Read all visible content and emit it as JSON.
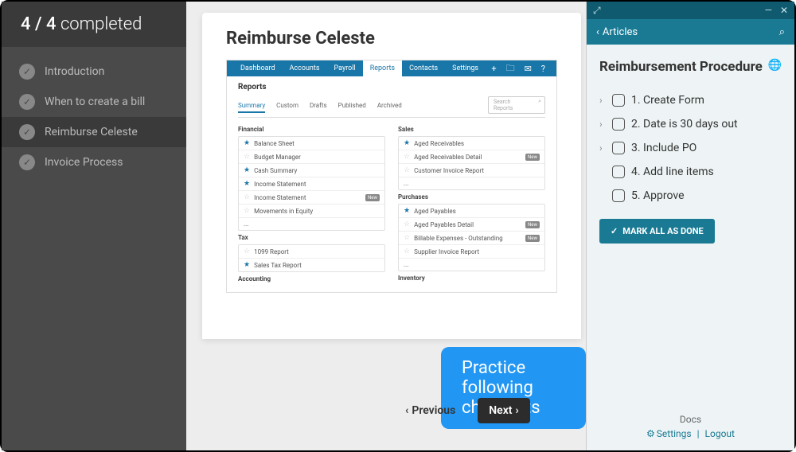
{
  "progress": {
    "done": "4",
    "total": "4",
    "suffix": "completed"
  },
  "sidebar": {
    "items": [
      {
        "label": "Introduction"
      },
      {
        "label": "When to create a bill"
      },
      {
        "label": "Reimburse Celeste"
      },
      {
        "label": "Invoice Process"
      }
    ]
  },
  "main": {
    "title": "Reimburse Celeste",
    "embed": {
      "nav": [
        "Dashboard",
        "Accounts",
        "Payroll",
        "Reports",
        "Contacts",
        "Settings"
      ],
      "nav_active": "Reports",
      "heading": "Reports",
      "tabs": [
        "Summary",
        "Custom",
        "Drafts",
        "Published",
        "Archived"
      ],
      "tab_active": "Summary",
      "search_placeholder": "Search Reports",
      "sections": {
        "financial": {
          "title": "Financial",
          "rows": [
            {
              "star": true,
              "label": "Balance Sheet"
            },
            {
              "star": false,
              "label": "Budget Manager"
            },
            {
              "star": true,
              "label": "Cash Summary"
            },
            {
              "star": true,
              "label": "Income Statement"
            },
            {
              "star": false,
              "label": "Income Statement",
              "badge": "New"
            },
            {
              "star": false,
              "label": "Movements in Equity"
            },
            {
              "star": false,
              "label": "..."
            }
          ]
        },
        "tax": {
          "title": "Tax",
          "rows": [
            {
              "star": false,
              "label": "1099 Report"
            },
            {
              "star": true,
              "label": "Sales Tax Report"
            }
          ]
        },
        "accounting": {
          "title": "Accounting"
        },
        "sales": {
          "title": "Sales",
          "rows": [
            {
              "star": true,
              "label": "Aged Receivables"
            },
            {
              "star": false,
              "label": "Aged Receivables Detail",
              "badge": "New"
            },
            {
              "star": false,
              "label": "Customer Invoice Report"
            },
            {
              "star": false,
              "label": "..."
            }
          ]
        },
        "purchases": {
          "title": "Purchases",
          "rows": [
            {
              "star": true,
              "label": "Aged Payables"
            },
            {
              "star": false,
              "label": "Aged Payables Detail",
              "badge": "New"
            },
            {
              "star": false,
              "label": "Billable Expenses - Outstanding",
              "badge": "New"
            },
            {
              "star": false,
              "label": "Supplier Invoice Report"
            },
            {
              "star": false,
              "label": "..."
            }
          ]
        },
        "inventory": {
          "title": "Inventory"
        }
      }
    }
  },
  "callout": "Practice following checklists",
  "nav": {
    "prev": "Previous",
    "next": "Next"
  },
  "help": {
    "back_label": "Articles",
    "title": "Reimbursement Procedure",
    "items": [
      {
        "label": "1. Create Form",
        "expandable": true
      },
      {
        "label": "2. Date is 30 days out",
        "expandable": true
      },
      {
        "label": "3. Include PO",
        "expandable": true
      },
      {
        "label": "4. Add line items",
        "expandable": false
      },
      {
        "label": "5. Approve",
        "expandable": false
      }
    ],
    "mark_all": "MARK ALL AS DONE",
    "footer": {
      "docs": "Docs",
      "settings": "Settings",
      "logout": "Logout"
    }
  }
}
